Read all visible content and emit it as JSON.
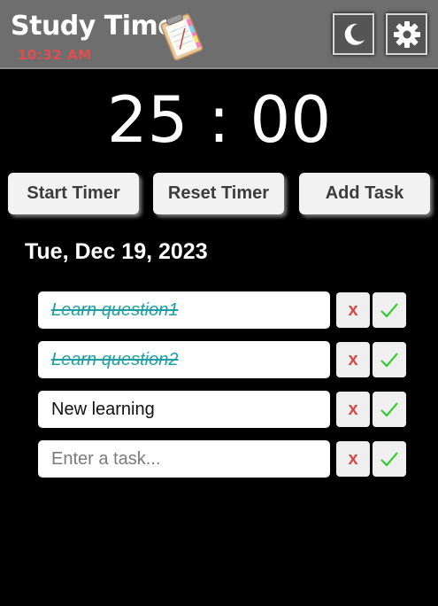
{
  "header": {
    "title": "Study Time",
    "clock": "10:32 AM",
    "icons": {
      "clipboard": "clipboard-icon",
      "theme_toggle": "moon-icon",
      "settings": "gear-icon"
    }
  },
  "timer": {
    "display": "25 : 00"
  },
  "controls": {
    "start_label": "Start Timer",
    "reset_label": "Reset Timer",
    "add_label": "Add Task"
  },
  "date": "Tue, Dec 19, 2023",
  "tasks": [
    {
      "text": "Learn question1",
      "completed": true
    },
    {
      "text": "Learn question2",
      "completed": true
    },
    {
      "text": "New learning",
      "completed": false
    }
  ],
  "new_task": {
    "placeholder": "Enter a task...",
    "value": ""
  },
  "task_actions": {
    "delete_label": "x"
  },
  "colors": {
    "background": "#000000",
    "header": "#6e6e6e",
    "clock": "#e34d4d",
    "completed_text": "#1e9fa3",
    "delete": "#d24a4a",
    "check": "#22cc22"
  }
}
